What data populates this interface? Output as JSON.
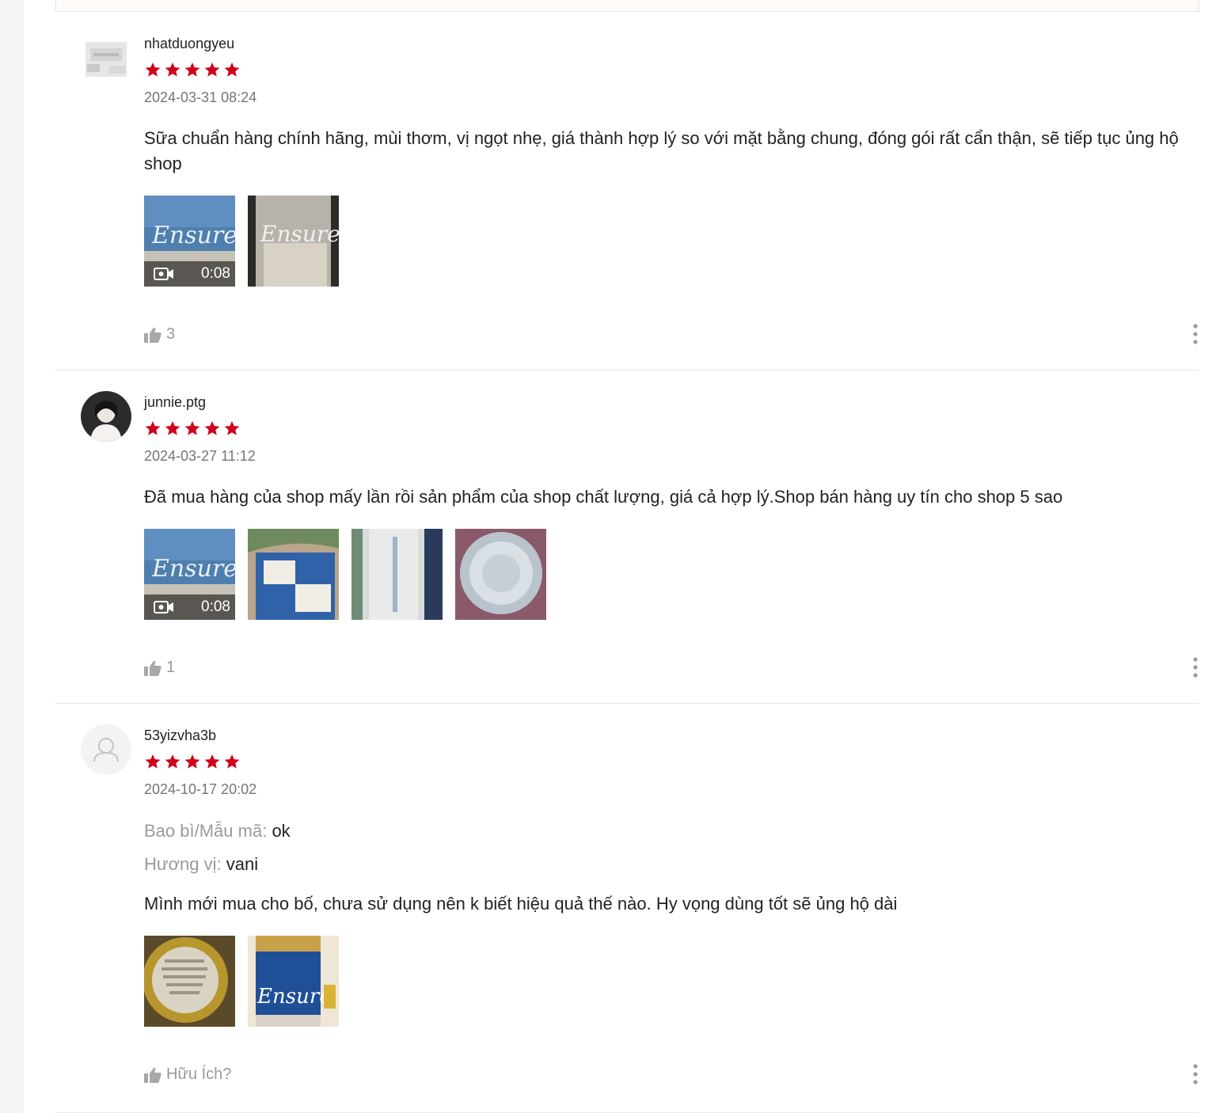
{
  "reviews": [
    {
      "username": "nhatduongyeu",
      "rating": 5,
      "date": "2024-03-31 08:24",
      "content": "Sữa chuẩn hàng chính hãng, mùi thơm, vị ngọt nhẹ, giá thành hợp lý so với mặt bằng chung, đóng gói rất cẩn thận, sẽ tiếp tục ủng hộ shop",
      "video_duration": "0:08",
      "likes": "3",
      "avatar_icon": "custom-avatar-image"
    },
    {
      "username": "junnie.ptg",
      "rating": 5,
      "date": "2024-03-27 11:12",
      "content": "Đã mua hàng của shop mấy lần rồi sản phẩm của shop chất lượng, giá cả hợp lý.Shop bán hàng uy tín cho shop 5 sao",
      "video_duration": "0:08",
      "likes": "1",
      "avatar_icon": "photo-avatar"
    },
    {
      "username": "53yizvha3b",
      "rating": 5,
      "date": "2024-10-17 20:02",
      "attributes": [
        {
          "label": "Bao bì/Mẫu mã:",
          "value": "ok"
        },
        {
          "label": "Hương vị:",
          "value": "vani"
        }
      ],
      "content": "Mình mới mua cho bố, chưa sử dụng nên k biết hiệu quả thế nào.  Hy vọng dùng tốt sẽ ủng hộ dài",
      "likes": "Hữu Ích?",
      "avatar_icon": "default-user-icon"
    }
  ],
  "colors": {
    "star": "#d0011b",
    "muted": "#757575",
    "text": "#222222"
  }
}
